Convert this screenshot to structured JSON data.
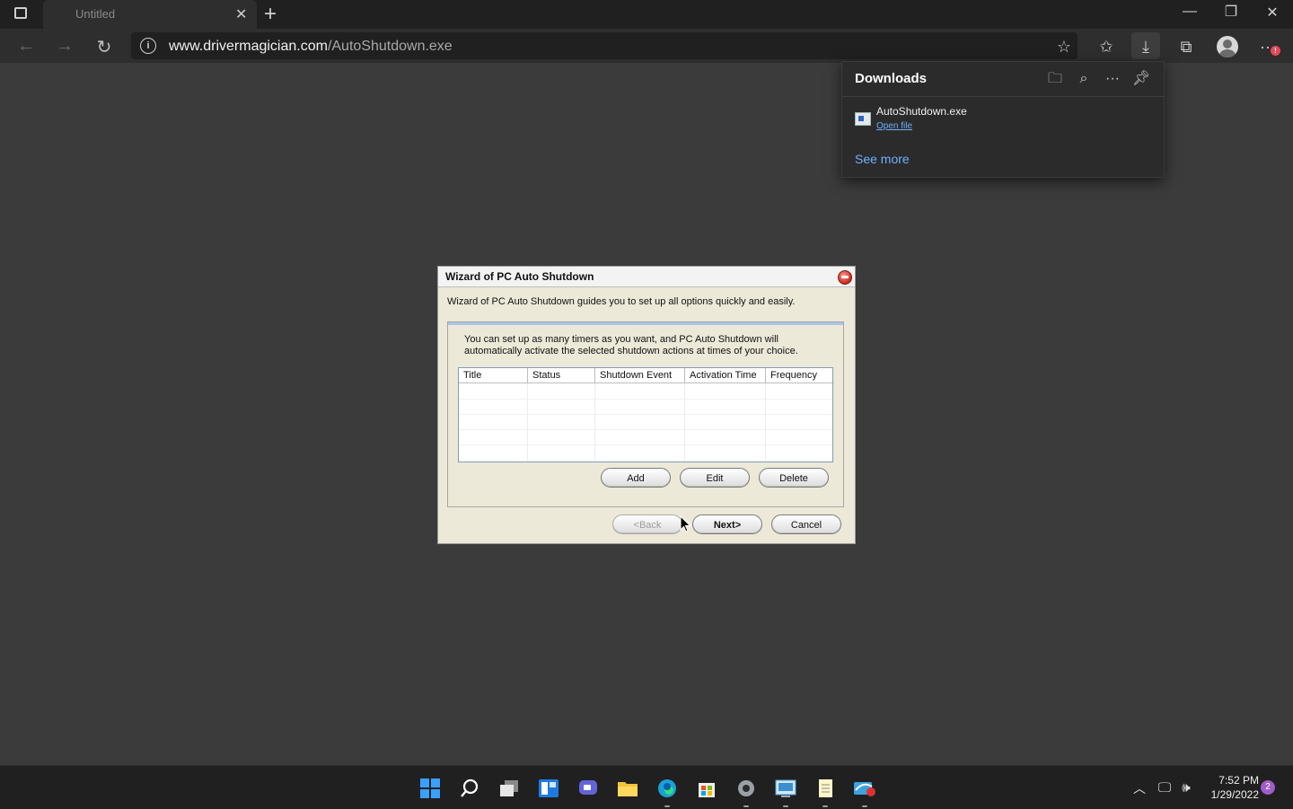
{
  "browser": {
    "tab": {
      "title": "Untitled"
    },
    "address": {
      "domain": "www.drivermagician.com",
      "path": "/AutoShutdown.exe"
    },
    "icons": {
      "back": "back-arrow-icon",
      "forward": "forward-arrow-icon",
      "refresh": "refresh-icon",
      "site_info": "info-icon",
      "add_favorite": "star-add-icon",
      "favorites": "favorites-icon",
      "downloads": "download-icon",
      "collections": "collections-icon",
      "profile": "avatar-icon",
      "more": "ellipsis-icon"
    },
    "menu_badge": "!"
  },
  "downloads_panel": {
    "title": "Downloads",
    "items": [
      {
        "name": "AutoShutdown.exe",
        "action": "Open file"
      }
    ],
    "see_more": "See more"
  },
  "dialog": {
    "title": "Wizard of PC Auto Shutdown",
    "intro": "Wizard of PC Auto Shutdown guides you to set up all options quickly and easily.",
    "group_text": "You can set up as many timers as you want, and PC Auto Shutdown will automatically activate the selected shutdown actions at times of your choice.",
    "columns": [
      "Title",
      "Status",
      "Shutdown Event",
      "Activation Time",
      "Frequency"
    ],
    "buttons": {
      "add": "Add",
      "edit": "Edit",
      "delete": "Delete",
      "back": "<Back",
      "next": "Next>",
      "cancel": "Cancel"
    }
  },
  "taskbar": {
    "apps": [
      "start-icon",
      "search-icon",
      "task-view-icon",
      "widgets-icon",
      "chat-icon",
      "file-explorer-icon",
      "edge-icon",
      "store-icon",
      "settings-icon",
      "control-panel-icon",
      "notepad-icon",
      "autoshutdown-icon"
    ],
    "time": "7:52 PM",
    "date": "1/29/2022",
    "notification_count": "2"
  },
  "colors": {
    "accent": "#6db0ff",
    "browser_bg": "#3b3b3b",
    "dialog_bg": "#ece9d8"
  }
}
